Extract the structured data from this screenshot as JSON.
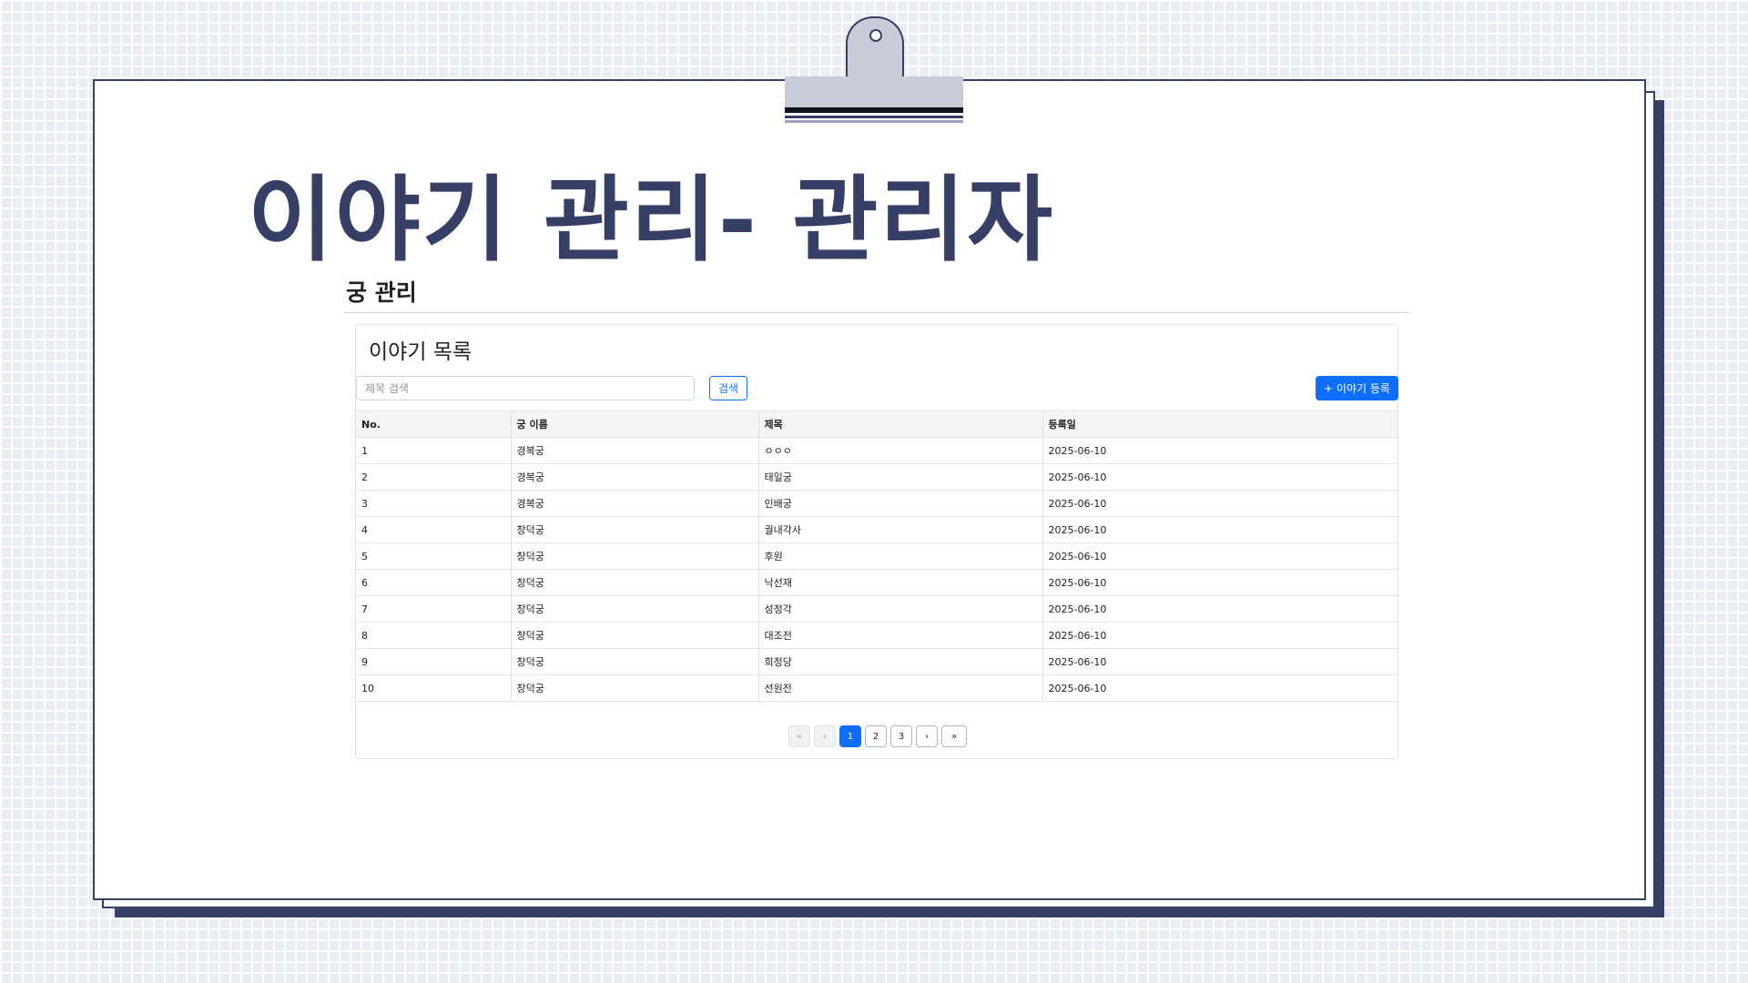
{
  "colors": {
    "navy": "#363f66",
    "primary": "#0d6efd",
    "grid_background": "#e9ecf3"
  },
  "header": {
    "title": "이야기 관리- 관리자"
  },
  "section": {
    "title": "궁 관리"
  },
  "card": {
    "title": "이야기 목록",
    "search_placeholder": "제목 검색",
    "search_label": "검색",
    "add_label": "+ 이야기 등록"
  },
  "table": {
    "columns": [
      "No.",
      "궁 이름",
      "제목",
      "등록일"
    ],
    "rows": [
      [
        "1",
        "경복궁",
        "ㅇㅇㅇ",
        "2025-06-10"
      ],
      [
        "2",
        "경복궁",
        "태일궁",
        "2025-06-10"
      ],
      [
        "3",
        "경복궁",
        "인배궁",
        "2025-06-10"
      ],
      [
        "4",
        "창덕궁",
        "궐내각사",
        "2025-06-10"
      ],
      [
        "5",
        "창덕궁",
        "후원",
        "2025-06-10"
      ],
      [
        "6",
        "창덕궁",
        "낙선재",
        "2025-06-10"
      ],
      [
        "7",
        "창덕궁",
        "성정각",
        "2025-06-10"
      ],
      [
        "8",
        "창덕궁",
        "대조전",
        "2025-06-10"
      ],
      [
        "9",
        "창덕궁",
        "희정당",
        "2025-06-10"
      ],
      [
        "10",
        "창덕궁",
        "선원전",
        "2025-06-10"
      ]
    ]
  },
  "pagination": {
    "first": "«",
    "prev": "‹",
    "pages": [
      "1",
      "2",
      "3"
    ],
    "current": "1",
    "next": "›",
    "last": "»"
  }
}
